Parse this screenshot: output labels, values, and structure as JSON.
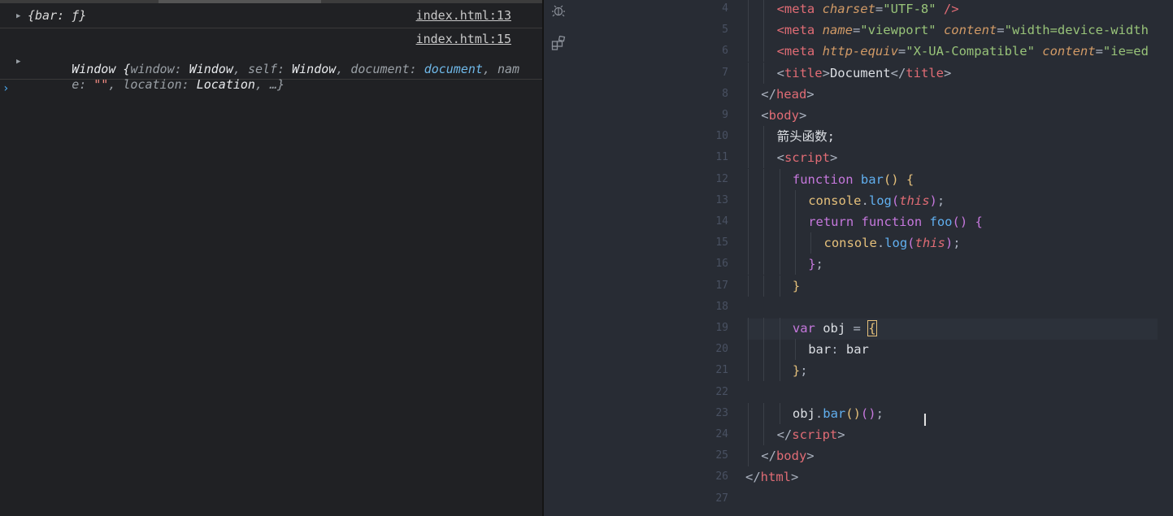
{
  "console": {
    "messages": [
      {
        "text": "{bar: ƒ}",
        "source": "index.html:13"
      },
      {
        "source": "index.html:15",
        "line1": [
          "Window ",
          "{",
          "window",
          ": ",
          "Window",
          ", ",
          "self",
          ": ",
          "Window",
          ", ",
          "document",
          ": ",
          "document",
          ", ",
          "nam"
        ],
        "line2": [
          "e",
          ": ",
          "\"\"",
          ", ",
          "location",
          ": ",
          "Location",
          ", …}"
        ]
      }
    ],
    "prompt": "›"
  },
  "editor": {
    "icons": [
      "bug-icon",
      "extensions-icon"
    ],
    "current_line": 19,
    "lines": [
      {
        "n": "4",
        "indent": 2,
        "tokens": [
          [
            "tag",
            "<meta"
          ],
          [
            "attr",
            " charset"
          ],
          [
            "pun",
            "="
          ],
          [
            "str",
            "\"UTF-8\""
          ],
          [
            "tag",
            " />"
          ]
        ]
      },
      {
        "n": "5",
        "indent": 2,
        "tokens": [
          [
            "tag",
            "<meta"
          ],
          [
            "attr",
            " name"
          ],
          [
            "pun",
            "="
          ],
          [
            "str",
            "\"viewport\""
          ],
          [
            "attr",
            " content"
          ],
          [
            "pun",
            "="
          ],
          [
            "str",
            "\"width=device-width"
          ]
        ]
      },
      {
        "n": "6",
        "indent": 2,
        "tokens": [
          [
            "tag",
            "<meta"
          ],
          [
            "attr",
            " http-equiv"
          ],
          [
            "pun",
            "="
          ],
          [
            "str",
            "\"X-UA-Compatible\""
          ],
          [
            "attr",
            " content"
          ],
          [
            "pun",
            "="
          ],
          [
            "str",
            "\"ie=ed"
          ]
        ]
      },
      {
        "n": "7",
        "indent": 2,
        "tokens": [
          [
            "pun",
            "<"
          ],
          [
            "tag",
            "title"
          ],
          [
            "pun",
            ">"
          ],
          [
            "plain",
            "Document"
          ],
          [
            "pun",
            "</"
          ],
          [
            "tag",
            "title"
          ],
          [
            "pun",
            ">"
          ]
        ]
      },
      {
        "n": "8",
        "indent": 1,
        "tokens": [
          [
            "pun",
            "</"
          ],
          [
            "tag",
            "head"
          ],
          [
            "pun",
            ">"
          ]
        ]
      },
      {
        "n": "9",
        "indent": 1,
        "tokens": [
          [
            "pun",
            "<"
          ],
          [
            "tag",
            "body"
          ],
          [
            "pun",
            ">"
          ]
        ]
      },
      {
        "n": "10",
        "indent": 2,
        "tokens": [
          [
            "plain",
            "箭头函数;"
          ]
        ]
      },
      {
        "n": "11",
        "indent": 2,
        "tokens": [
          [
            "pun",
            "<"
          ],
          [
            "tag",
            "script"
          ],
          [
            "pun",
            ">"
          ]
        ]
      },
      {
        "n": "12",
        "indent": 3,
        "tokens": [
          [
            "kw",
            "function"
          ],
          [
            "fn",
            " bar"
          ],
          [
            "br1",
            "()"
          ],
          [
            "pun",
            " "
          ],
          [
            "br1",
            "{"
          ]
        ]
      },
      {
        "n": "13",
        "indent": 4,
        "tokens": [
          [
            "mth",
            "console"
          ],
          [
            "pun",
            "."
          ],
          [
            "fn",
            "log"
          ],
          [
            "br2",
            "("
          ],
          [
            "thisk",
            "this"
          ],
          [
            "br2",
            ")"
          ],
          [
            "pun",
            ";"
          ]
        ]
      },
      {
        "n": "14",
        "indent": 4,
        "tokens": [
          [
            "kw",
            "return"
          ],
          [
            "kw",
            " function"
          ],
          [
            "fn",
            " foo"
          ],
          [
            "br2",
            "()"
          ],
          [
            "pun",
            " "
          ],
          [
            "br2",
            "{"
          ]
        ]
      },
      {
        "n": "15",
        "indent": 5,
        "tokens": [
          [
            "mth",
            "console"
          ],
          [
            "pun",
            "."
          ],
          [
            "fn",
            "log"
          ],
          [
            "br2",
            "("
          ],
          [
            "thisk",
            "this"
          ],
          [
            "br2",
            ")"
          ],
          [
            "pun",
            ";"
          ]
        ]
      },
      {
        "n": "16",
        "indent": 4,
        "tokens": [
          [
            "br2",
            "}"
          ],
          [
            "pun",
            ";"
          ]
        ]
      },
      {
        "n": "17",
        "indent": 3,
        "tokens": [
          [
            "br1",
            "}"
          ]
        ]
      },
      {
        "n": "18",
        "indent": 0,
        "tokens": []
      },
      {
        "n": "19",
        "indent": 3,
        "tokens": [
          [
            "kw",
            "var"
          ],
          [
            "plain",
            " obj"
          ],
          [
            "pun",
            " = "
          ],
          [
            "br1",
            "{"
          ]
        ]
      },
      {
        "n": "20",
        "indent": 4,
        "tokens": [
          [
            "plain",
            "bar"
          ],
          [
            "pun",
            ": "
          ],
          [
            "plain",
            "bar"
          ]
        ]
      },
      {
        "n": "21",
        "indent": 3,
        "tokens": [
          [
            "br1",
            "}"
          ],
          [
            "pun",
            ";"
          ]
        ]
      },
      {
        "n": "22",
        "indent": 0,
        "tokens": []
      },
      {
        "n": "23",
        "indent": 3,
        "tokens": [
          [
            "plain",
            "obj"
          ],
          [
            "pun",
            "."
          ],
          [
            "fn",
            "bar"
          ],
          [
            "br1",
            "()"
          ],
          [
            "br2",
            "()"
          ],
          [
            "pun",
            ";"
          ]
        ]
      },
      {
        "n": "24",
        "indent": 2,
        "tokens": [
          [
            "pun",
            "</"
          ],
          [
            "tag",
            "script"
          ],
          [
            "pun",
            ">"
          ]
        ]
      },
      {
        "n": "25",
        "indent": 1,
        "tokens": [
          [
            "pun",
            "</"
          ],
          [
            "tag",
            "body"
          ],
          [
            "pun",
            ">"
          ]
        ]
      },
      {
        "n": "26",
        "indent": 0,
        "tokens": [
          [
            "pun",
            "</"
          ],
          [
            "tag",
            "html"
          ],
          [
            "pun",
            ">"
          ]
        ]
      },
      {
        "n": "27",
        "indent": 0,
        "tokens": []
      }
    ]
  }
}
